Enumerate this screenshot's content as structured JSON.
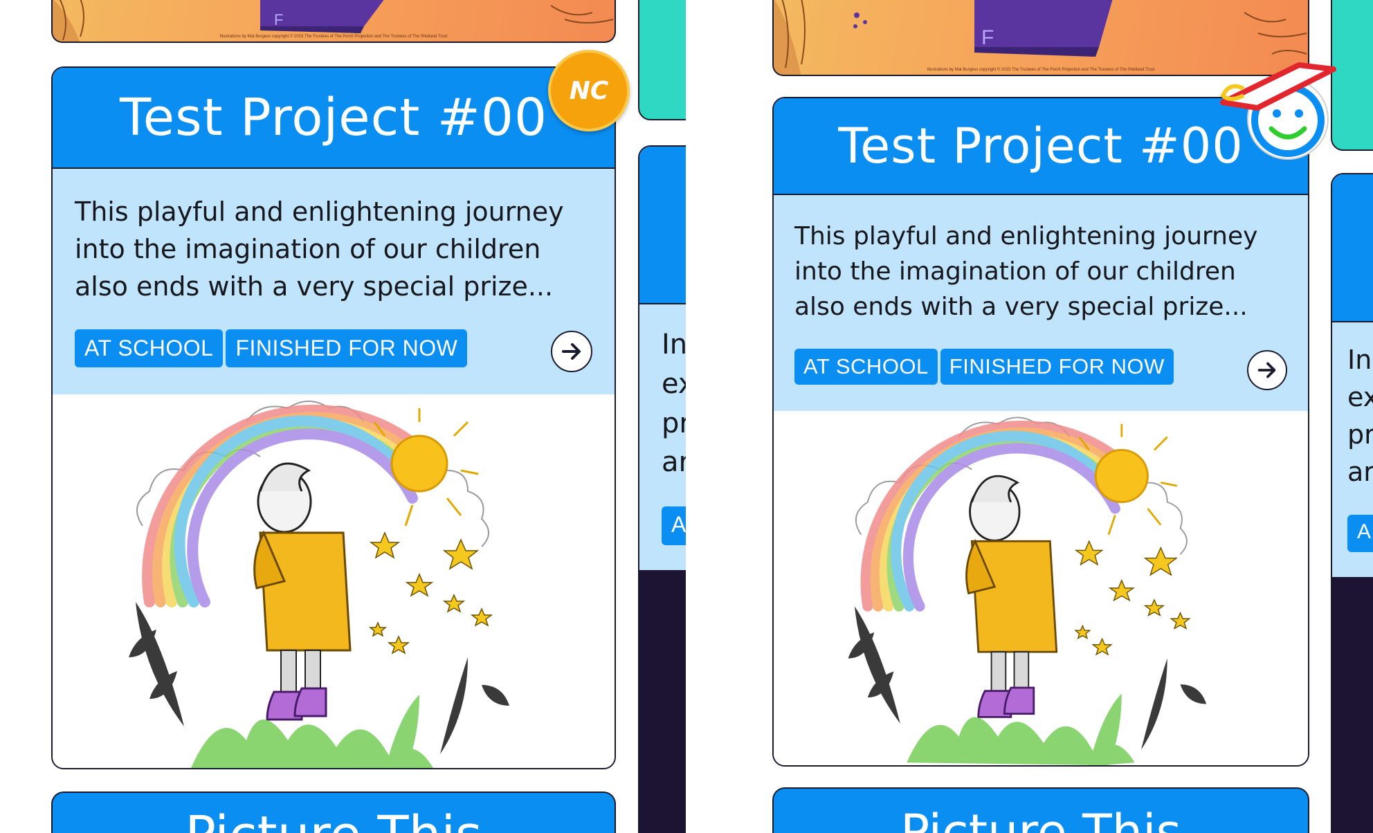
{
  "left_panel": {
    "book_credit": "Illustrations by Mat Burgess copyright © 2023 The Trustees of The Porch Projection and The Trustees of The Shetland Trust",
    "card": {
      "title": "Test Project #00",
      "badge_label": "NC",
      "description": "This playful and enlightening journey into the imagination of our children also ends with a very special prize...",
      "tags": [
        "AT SCHOOL",
        "FINISHED FOR NOW"
      ],
      "arrow_icon": "arrow-right-icon",
      "image_alt": "child-looking-at-rainbow-illustration"
    },
    "neighbor": {
      "text_lines": [
        "In",
        "ex",
        "pr",
        "ar"
      ],
      "tag_fragment": "A"
    },
    "next_card_title": "Picture This"
  },
  "right_panel": {
    "book_credit": "Illustrations by Mat Burgess copyright © 2023 The Trustees of The Porch Projection and The Trustees of The Shetland Trust",
    "card": {
      "title": "Test Project #00",
      "badge_icon": "graduate-smiley-icon",
      "description": "This playful and enlightening journey into the imagination of our children also ends with a very special prize...",
      "tags": [
        "AT SCHOOL",
        "FINISHED FOR NOW"
      ],
      "arrow_icon": "arrow-right-icon",
      "image_alt": "child-looking-at-rainbow-illustration"
    },
    "neighbor": {
      "text_lines": [
        "In",
        "ex",
        "pr",
        "ar"
      ],
      "tag_fragment": "A"
    },
    "next_card_title": "Picture This"
  },
  "colors": {
    "header_blue": "#0b8ef2",
    "body_light_blue": "#bfe4fb",
    "teal": "#2fd8c2",
    "badge_orange": "#f5a20d",
    "dark_navy": "#1d1432",
    "border": "#1a1a2e"
  }
}
